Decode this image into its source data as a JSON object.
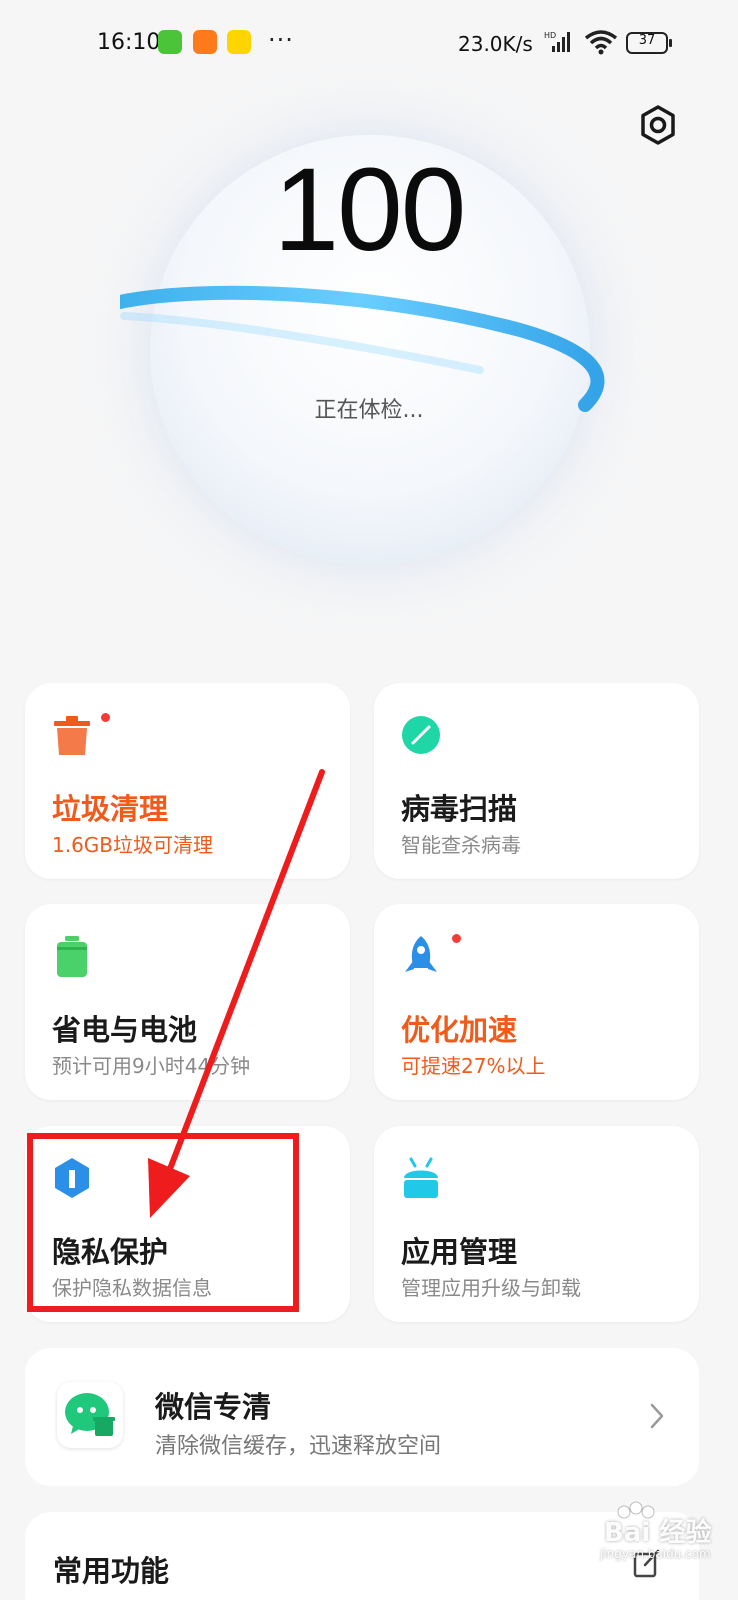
{
  "status_bar": {
    "time": "16:10",
    "dots": "···",
    "net_speed": "23.0K/s",
    "hd_label": "HD",
    "battery_level": "37"
  },
  "header": {
    "settings_icon": "gear-icon"
  },
  "score": {
    "value": "100",
    "status": "正在体检..."
  },
  "cards": [
    {
      "title": "垃圾清理",
      "sub": "1.6GB垃圾可清理",
      "icon": "trash-icon",
      "accent": "#f05a1a",
      "has_dot": true
    },
    {
      "title": "病毒扫描",
      "sub": "智能查杀病毒",
      "icon": "virus-scan-icon",
      "accent": "#1fd6a6",
      "has_dot": false
    },
    {
      "title": "省电与电池",
      "sub": "预计可用9小时44分钟",
      "icon": "battery-icon",
      "accent": "#4bd16a",
      "has_dot": false
    },
    {
      "title": "优化加速",
      "sub": "可提速27%以上",
      "icon": "rocket-icon",
      "accent": "#f05a1a",
      "has_dot": true
    },
    {
      "title": "隐私保护",
      "sub": "保护隐私数据信息",
      "icon": "privacy-shield-icon",
      "accent": "#2b8fe8",
      "has_dot": false
    },
    {
      "title": "应用管理",
      "sub": "管理应用升级与卸载",
      "icon": "android-icon",
      "accent": "#22c8e8",
      "has_dot": false
    }
  ],
  "wechat": {
    "title": "微信专清",
    "sub": "清除微信缓存，迅速释放空间",
    "icon": "wechat-clean-icon"
  },
  "common": {
    "title": "常用功能"
  },
  "watermark": {
    "text": "Bai 经验",
    "url": "jingyan.baidu.com"
  },
  "colors": {
    "warn": "#f05a1a",
    "annotation": "#ee1c1c",
    "ring": "#2aa9ea"
  }
}
